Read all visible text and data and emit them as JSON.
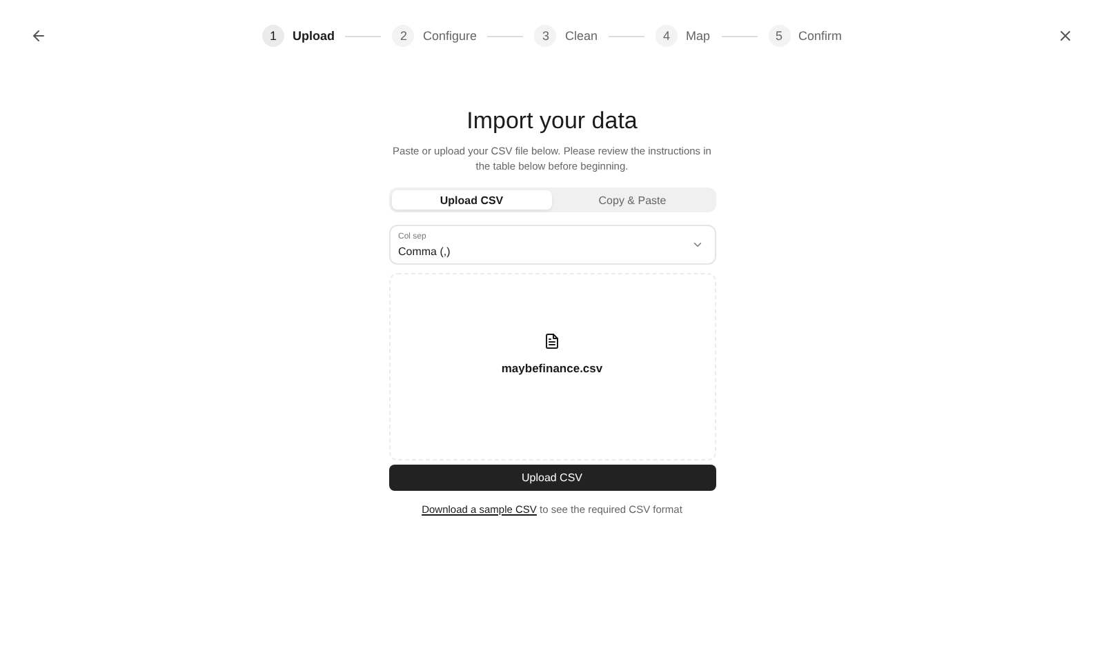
{
  "steps": [
    {
      "number": "1",
      "label": "Upload",
      "selected": true
    },
    {
      "number": "2",
      "label": "Configure",
      "selected": false
    },
    {
      "number": "3",
      "label": "Clean",
      "selected": false
    },
    {
      "number": "4",
      "label": "Map",
      "selected": false
    },
    {
      "number": "5",
      "label": "Confirm",
      "selected": false
    }
  ],
  "title": "Import your data",
  "description": "Paste or upload your CSV file below. Please review the instructions in the table below before beginning.",
  "tabs": [
    {
      "label": "Upload CSV",
      "selected": true
    },
    {
      "label": "Copy & Paste",
      "selected": false
    }
  ],
  "separator": {
    "label": "Col sep",
    "value": "Comma (,)"
  },
  "file": {
    "name": "maybefinance.csv"
  },
  "submit": "Upload CSV",
  "footer": {
    "link": "Download a sample CSV",
    "text": "to see the required CSV format"
  }
}
